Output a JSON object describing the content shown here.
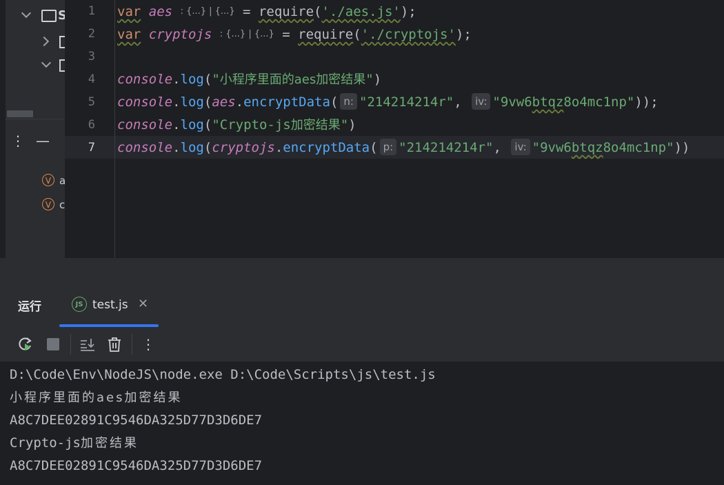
{
  "project_panel": {
    "root_initial": "S",
    "var_badge_letter": "V",
    "var_items": [
      "a",
      "c"
    ]
  },
  "editor": {
    "line_numbers": [
      "1",
      "2",
      "3",
      "4",
      "5",
      "6",
      "7"
    ],
    "lines": {
      "l1": {
        "kw": "var",
        "name": "aes",
        "fold": ": {...} | {...}",
        "rest1": " = ",
        "fn": "require",
        "open": "(",
        "arg": "'./aes.js'",
        "close": ");"
      },
      "l2": {
        "kw": "var",
        "name": "cryptojs",
        "fold": ": {...} | {...}",
        "rest1": " = ",
        "fn": "require",
        "open": "(",
        "arg": "'./cryptojs'",
        "close": ");"
      },
      "l4": {
        "obj": "console",
        "dot": ".",
        "fn": "log",
        "open": "(",
        "q1": "\"",
        "arg": "小程序里面的aes加密结果",
        "q2": "\"",
        "close": ")"
      },
      "l5": {
        "obj": "console",
        "dot": ".",
        "fn": "log",
        "open": "(",
        "ident": "aes",
        "dot2": ".",
        "fn2": "encryptData",
        "open2": "(",
        "hint1": "n:",
        "arg1": "\"214214214r\"",
        "comma": ",",
        "hint2": "iv:",
        "arg2q": "\"",
        "arg2a": "9vw6",
        "arg2b": "btqz",
        "arg2c": "8o4mc1np\"",
        "close": "));"
      },
      "l6": {
        "obj": "console",
        "dot": ".",
        "fn": "log",
        "open": "(",
        "arg_a": "\"Crypto-js",
        "arg_b": "加密结果",
        "arg_c": "\"",
        "close": ")"
      },
      "l7": {
        "obj": "console",
        "dot": ".",
        "fn": "log",
        "open": "(",
        "ident": "cryptojs",
        "dot2": ".",
        "fn2": "encryptData",
        "open2": "(",
        "hint1": "p:",
        "arg1": "\"214214214r\"",
        "comma": ",",
        "hint2": "iv:",
        "arg2q": "\"",
        "arg2a": "9vw6",
        "arg2b": "btqz",
        "arg2c": "8o4mc1np\"",
        "close": "))"
      }
    }
  },
  "run_window": {
    "title": "运行",
    "tab": {
      "icon": "JS",
      "label": "test.js",
      "close": "✕"
    },
    "console_lines": {
      "c1": "D:\\Code\\Env\\NodeJS\\node.exe D:\\Code\\Scripts\\js\\test.js",
      "c2": "小程序里面的aes加密结果",
      "c3": "A8C7DEE02891C9546DA325D77D3D6DE7",
      "c4a": "Crypto-js",
      "c4b": "加密结果",
      "c5": "A8C7DEE02891C9546DA325D77D3D6DE7"
    }
  },
  "colors": {
    "keyword": "#cf8e6d",
    "identifier": "#c77dbb",
    "function": "#56a8f5",
    "string": "#6aab73",
    "accent": "#3574f0"
  }
}
